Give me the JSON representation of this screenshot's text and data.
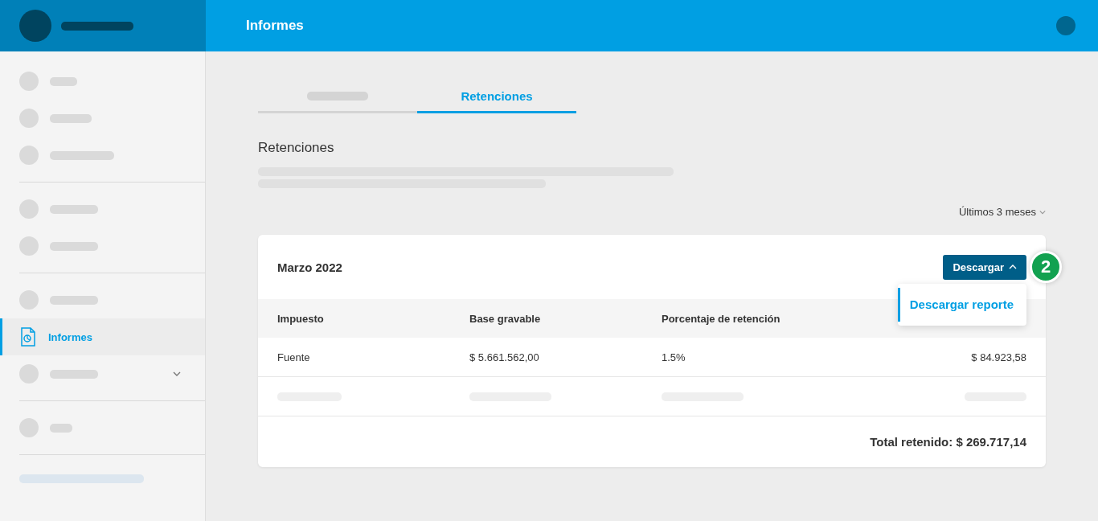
{
  "header": {
    "title": "Informes"
  },
  "sidebar": {
    "groups": [
      [
        {
          "kind": "placeholder",
          "selected": false
        },
        {
          "kind": "placeholder",
          "selected": false
        },
        {
          "kind": "placeholder",
          "selected": false
        }
      ],
      [
        {
          "kind": "placeholder",
          "selected": false
        },
        {
          "kind": "placeholder",
          "selected": false
        }
      ],
      [
        {
          "kind": "placeholder",
          "selected": false
        },
        {
          "kind": "report",
          "label": "Informes",
          "selected": true
        },
        {
          "kind": "expandable",
          "selected": false
        }
      ],
      [
        {
          "kind": "placeholder",
          "selected": false
        }
      ]
    ]
  },
  "tabs": [
    {
      "kind": "placeholder",
      "selected": false
    },
    {
      "kind": "text",
      "label": "Retenciones",
      "selected": true
    }
  ],
  "section": {
    "title": "Retenciones"
  },
  "filter": {
    "label": "Últimos 3 meses"
  },
  "card": {
    "title": "Marzo 2022",
    "download": {
      "label": "Descargar",
      "expanded": true,
      "menu": [
        "Descargar reporte"
      ]
    },
    "step_badge": "2",
    "table": {
      "columns": [
        "Impuesto",
        "Base gravable",
        "Porcentaje de retención"
      ],
      "rows": [
        {
          "kind": "data",
          "cells": [
            "Fuente",
            "$ 5.661.562,00",
            "1.5%",
            "$ 84.923,58"
          ]
        },
        {
          "kind": "placeholder"
        }
      ]
    },
    "total": "Total retenido: $ 269.717,14"
  }
}
